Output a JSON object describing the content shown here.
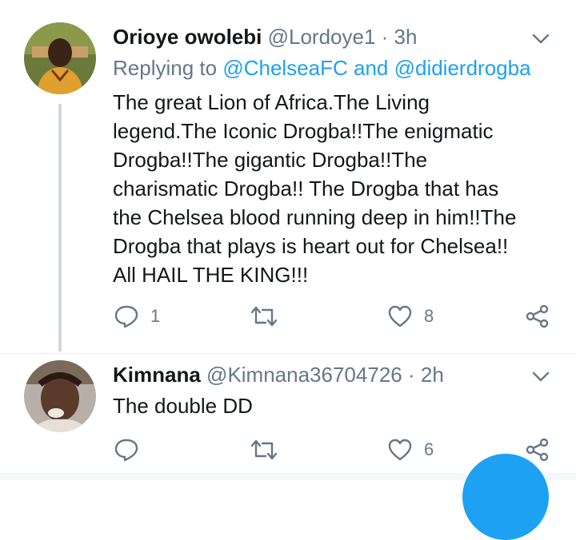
{
  "tweets": [
    {
      "name": "Orioye owolebi",
      "handle": "@Lordoye1",
      "time": "3h",
      "replying_prefix": "Replying to ",
      "replying_to_1": "@ChelseaFC",
      "replying_and": " and ",
      "replying_to_2": "@didierdrogba",
      "text_lines": [
        "The great Lion of Africa.The Living",
        "legend.The Iconic Drogba!!The enigmatic",
        "Drogba!!The gigantic Drogba!!The",
        "charismatic Drogba!! The Drogba that has",
        "the Chelsea blood running deep in him!!The",
        "Drogba that plays is heart out for Chelsea!!",
        "All HAIL THE KING!!!"
      ],
      "reply_count": "1",
      "like_count": "8",
      "avatar_icon": "avatar-photo"
    },
    {
      "name": "Kimnana",
      "handle": "@Kimnana36704726",
      "time": "2h",
      "text": "The double DD",
      "reply_count": "",
      "like_count": "6",
      "avatar_icon": "avatar-photo"
    }
  ],
  "separator": " · ",
  "colors": {
    "accent": "#1da1f2",
    "muted": "#657786",
    "text": "#14171a",
    "line": "#cfd9de"
  }
}
